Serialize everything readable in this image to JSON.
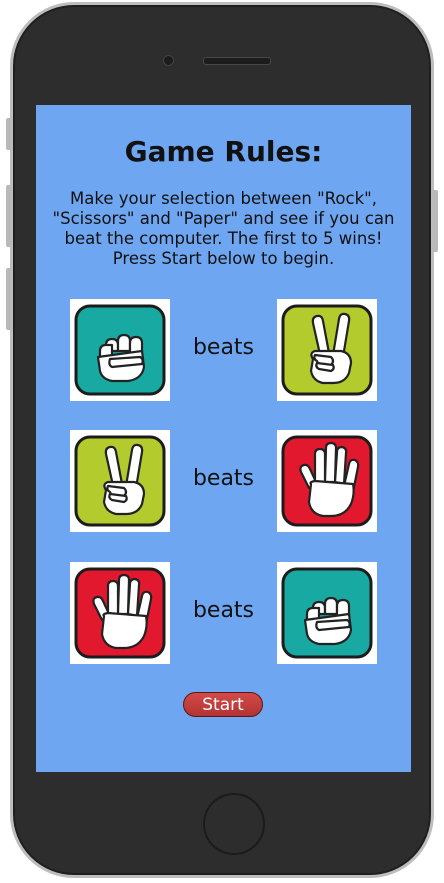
{
  "rules": {
    "title": "Game Rules:",
    "text": "Make your selection between \"Rock\", \"Scissors\" and \"Paper\" and see if you can beat the computer. The first to 5 wins! Press Start below to begin."
  },
  "matchups": [
    {
      "winner": "rock",
      "verb": "beats",
      "loser": "scissors"
    },
    {
      "winner": "scissors",
      "verb": "beats",
      "loser": "paper"
    },
    {
      "winner": "paper",
      "verb": "beats",
      "loser": "rock"
    }
  ],
  "icons": {
    "rock": {
      "name": "rock-fist-icon",
      "color": "#17a9a2"
    },
    "scissors": {
      "name": "scissors-peace-hand-icon",
      "color": "#b3cb2d"
    },
    "paper": {
      "name": "paper-open-hand-icon",
      "color": "#e2192e"
    }
  },
  "start_label": "Start",
  "colors": {
    "screen_background": "#6ea6f1",
    "start_button": "#c04241",
    "phone_body": "#2d2d2d"
  }
}
